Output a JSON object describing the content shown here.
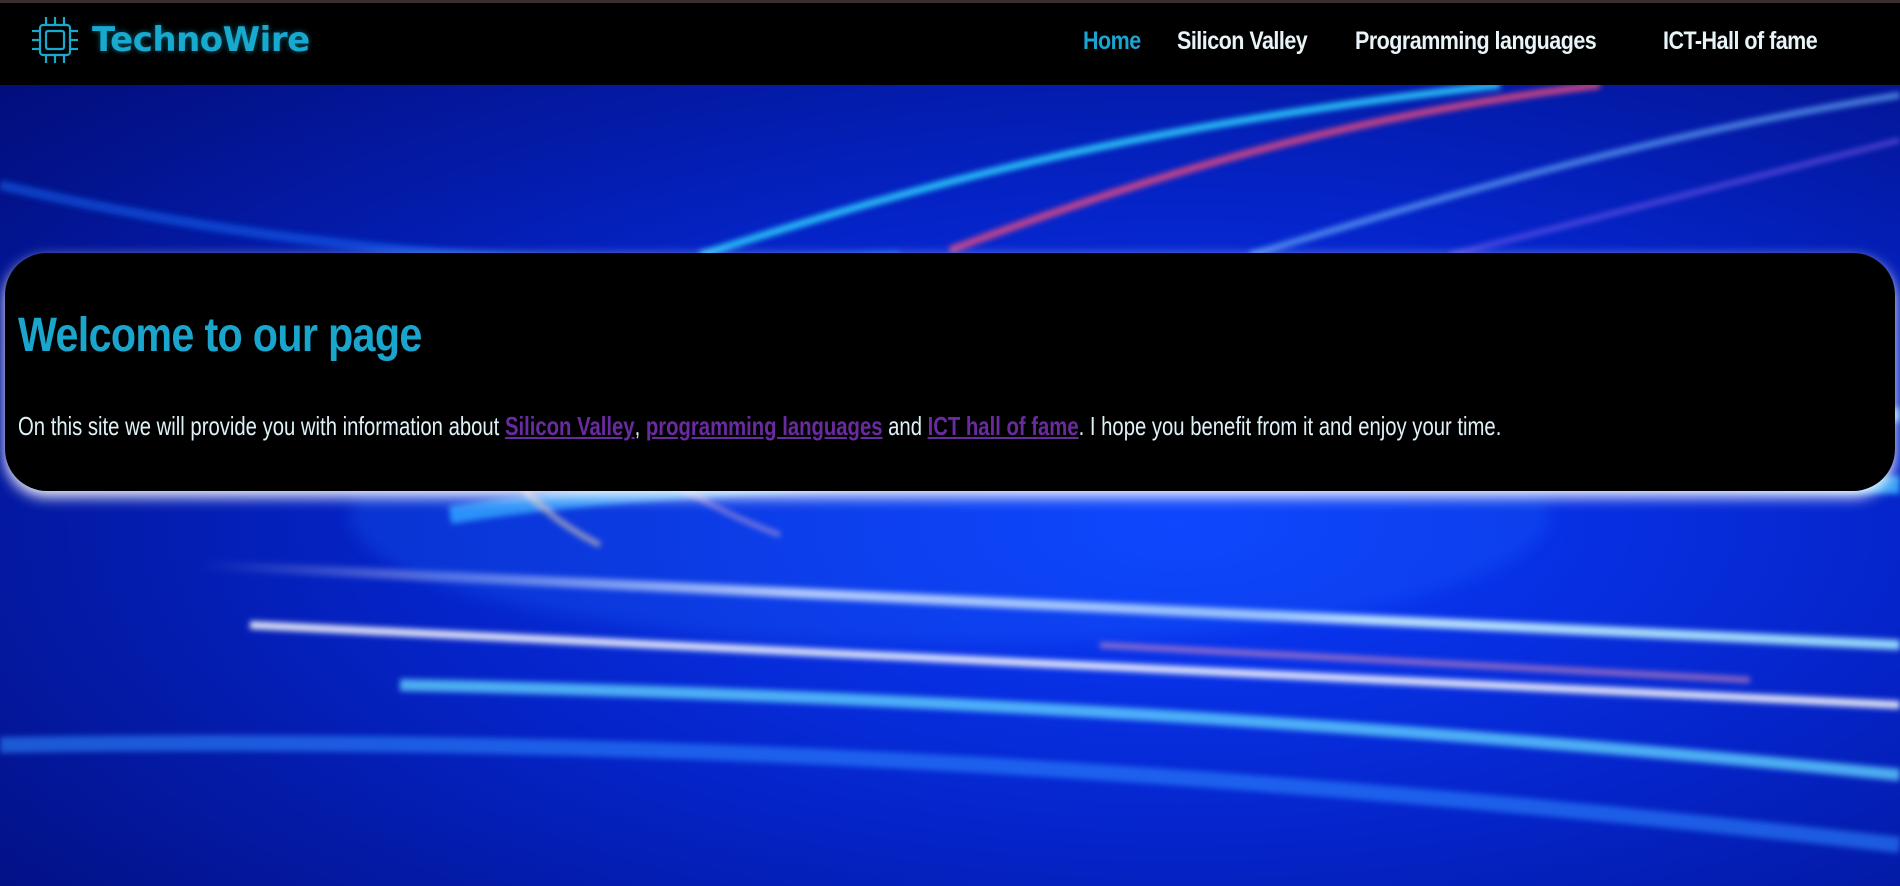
{
  "brand": {
    "logo_icon": "chip-icon",
    "name": "TechnoWire",
    "color": "#18a9cf"
  },
  "nav": {
    "items": [
      {
        "label": "Home",
        "active": true
      },
      {
        "label": "Silicon Valley",
        "active": false
      },
      {
        "label": "Programming languages",
        "active": false
      },
      {
        "label": "ICT-Hall of fame",
        "active": false
      }
    ],
    "active_color": "#19a4d2",
    "text_color": "#e8f4f8"
  },
  "welcome": {
    "title": "Welcome to our page",
    "intro": "On this site we will provide you with information about ",
    "link_silicon": "Silicon Valley",
    "sep_comma": ", ",
    "link_languages": "programming languages",
    "sep_and": " and ",
    "link_ict": "ICT hall of fame",
    "outro": ". I hope you benefit from it and enjoy your time.",
    "link_color": "#6a2aa0"
  }
}
